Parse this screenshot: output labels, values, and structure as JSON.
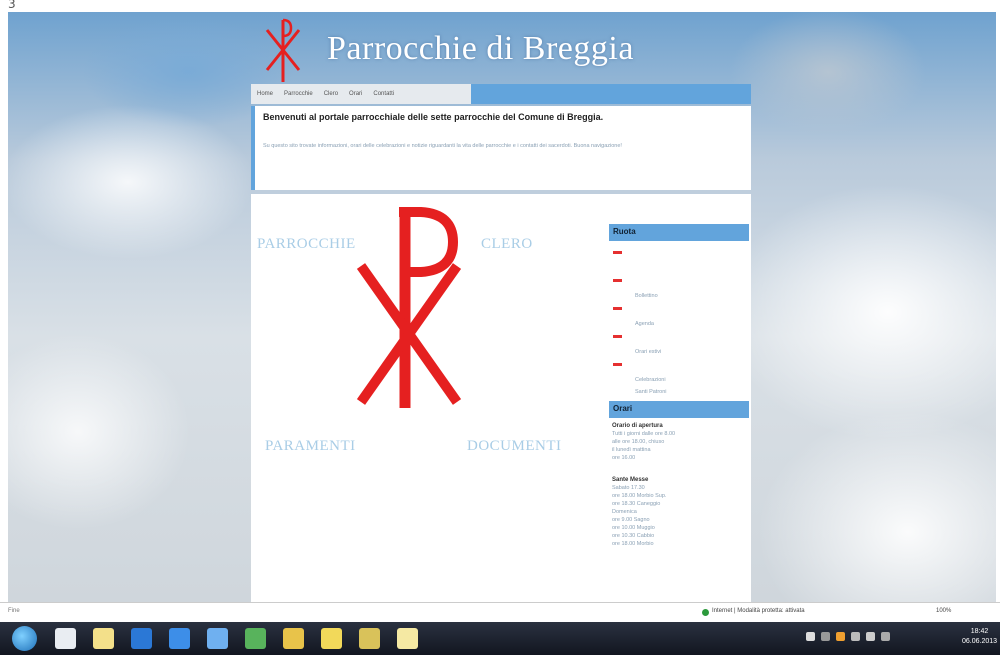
{
  "window": {
    "title": "3"
  },
  "header": {
    "site_title": "Parrocchie di Breggia"
  },
  "nav": {
    "items": [
      "Home",
      "Parrocchie",
      "Clero",
      "Orari",
      "Contatti"
    ]
  },
  "intro": {
    "welcome": "Benvenuti al portale parrocchiale delle sette parrocchie del Comune di Breggia.",
    "body": "Su questo sito trovate informazioni, orari delle celebrazioni e notizie riguardanti la vita delle parrocchie e i contatti dei sacerdoti. Buona navigazione!"
  },
  "content": {
    "words": [
      "PARROCCHIE",
      "CLERO",
      "PARAMENTI",
      "DOCUMENTI"
    ]
  },
  "sidebar": {
    "links_heading": "Ruota",
    "links": [
      "",
      "Bollettino",
      "Agenda",
      "Orari estivi",
      "Celebrazioni",
      "Santi Patroni"
    ],
    "orari_heading": "Orari",
    "orari_blocks": [
      {
        "title": "Orario di apertura",
        "lines": [
          "Tutti i giorni dalle ore 8.00",
          "alle ore 18.00, chiuso",
          "il lunedì mattina",
          "ore 16.00"
        ]
      },
      {
        "title": "Sante Messe",
        "lines": [
          "Sabato 17.30",
          "ore 18.00 Morbio Sup.",
          "ore 18.30 Caneggio",
          "Domenica",
          "ore 9.00 Sagno",
          "ore 10.00 Muggio",
          "ore 10.30 Cabbio",
          "ore 18.00 Morbio"
        ]
      }
    ]
  },
  "statusbar": {
    "left": "Fine",
    "zone": "Internet | Modalità protetta: attivata",
    "zoom": "100%"
  },
  "taskbar": {
    "clock_time": "18:42",
    "clock_date": "06.06.2013"
  },
  "colors": {
    "accent": "#62a4dc",
    "chi_rho": "#e52020",
    "link_word": "#a9cde6"
  }
}
